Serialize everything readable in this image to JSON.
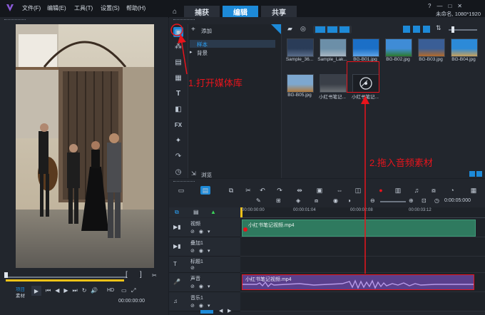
{
  "menu": {
    "file": "文件(F)",
    "edit": "编辑(E)",
    "tools": "工具(T)",
    "settings": "设置(S)",
    "help": "帮助(H)"
  },
  "tabs": {
    "capture": "捕获",
    "edit": "编辑",
    "share": "共享"
  },
  "project": {
    "title": "未命名, 1080*1920"
  },
  "library": {
    "add_label": "添加",
    "folders": [
      "样本",
      "背景"
    ],
    "browse_label": "浏览",
    "thumbs": [
      {
        "label": "Sample_36...",
        "colors": [
          "#2a3c58",
          "#5a6d8a"
        ]
      },
      {
        "label": "Sample_Lak...",
        "colors": [
          "#6c8fa8",
          "#a9b8c4"
        ]
      },
      {
        "label": "BG-B01.jpg",
        "colors": [
          "#1b6fc7",
          "#5fa3e6"
        ]
      },
      {
        "label": "BG-B02.jpg",
        "colors": [
          "#3f8cd6",
          "#2d7a2c"
        ]
      },
      {
        "label": "BG-B03.jpg",
        "colors": [
          "#3a5e96",
          "#b46a2a"
        ]
      },
      {
        "label": "BG-B04.jpg",
        "colors": [
          "#2c8ad8",
          "#c9a15a"
        ]
      },
      {
        "label": "BG-B05.jpg",
        "colors": [
          "#7da7cf",
          "#b07a3c"
        ]
      },
      {
        "label": "小红书笔记...",
        "colors": [
          "#3a3f48",
          "#6b6f74"
        ]
      },
      {
        "label": "小红书笔记...",
        "colors": [
          "#1b1e24",
          "#1b1e24"
        ]
      }
    ]
  },
  "annotations": {
    "step1": "1.打开媒体库",
    "step2": "2.拖入音频素材"
  },
  "preview": {
    "project_label": "项目",
    "clip_label": "素材",
    "hd_label": "HD",
    "timecode": "00:00:00:00"
  },
  "timeline": {
    "ruler": [
      "00:00:00:00",
      "00:00:01:04",
      "00:00:02:08",
      "00:00:03:12"
    ],
    "zoom_time": "0:00:05:000",
    "tracks": [
      {
        "name": "视频",
        "clip": "小红书笔记视频.mp4"
      },
      {
        "name": "叠加1",
        "clip": ""
      },
      {
        "name": "标题1",
        "clip": ""
      },
      {
        "name": "声音",
        "clip": "小红书笔记视频.mp4"
      },
      {
        "name": "音乐1",
        "clip": ""
      }
    ]
  },
  "colors": {
    "accent": "#1d8ad8",
    "annotation_red": "#e8141c",
    "video_clip": "#2f7a5f",
    "audio_clip": "#5a3f8c"
  }
}
